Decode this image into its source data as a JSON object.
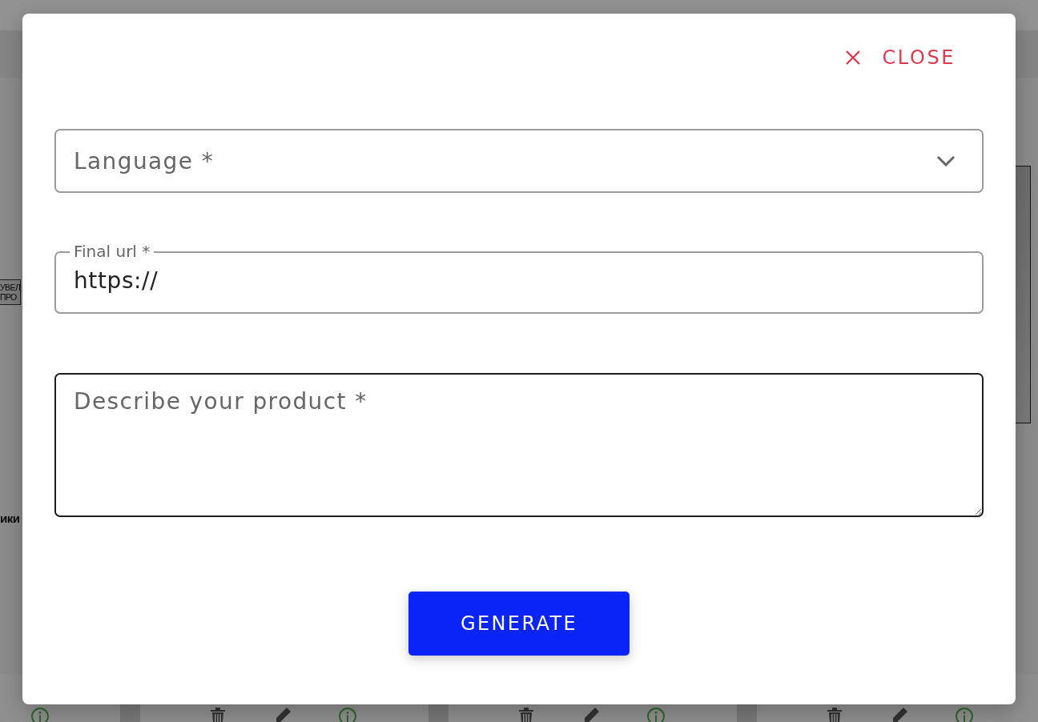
{
  "background_page": {
    "badge": {
      "lines": [
        "УВЕЛ",
        "ПРО"
      ]
    },
    "heading_fragment": "ики"
  },
  "dialog": {
    "close_button": {
      "label": "CLOSE"
    },
    "language_select": {
      "placeholder": "Language *"
    },
    "final_url": {
      "label": "Final url *",
      "value": "https://"
    },
    "description": {
      "placeholder": "Describe your product *",
      "focused": true
    },
    "generate_button": {
      "label": "GENERATE"
    }
  }
}
